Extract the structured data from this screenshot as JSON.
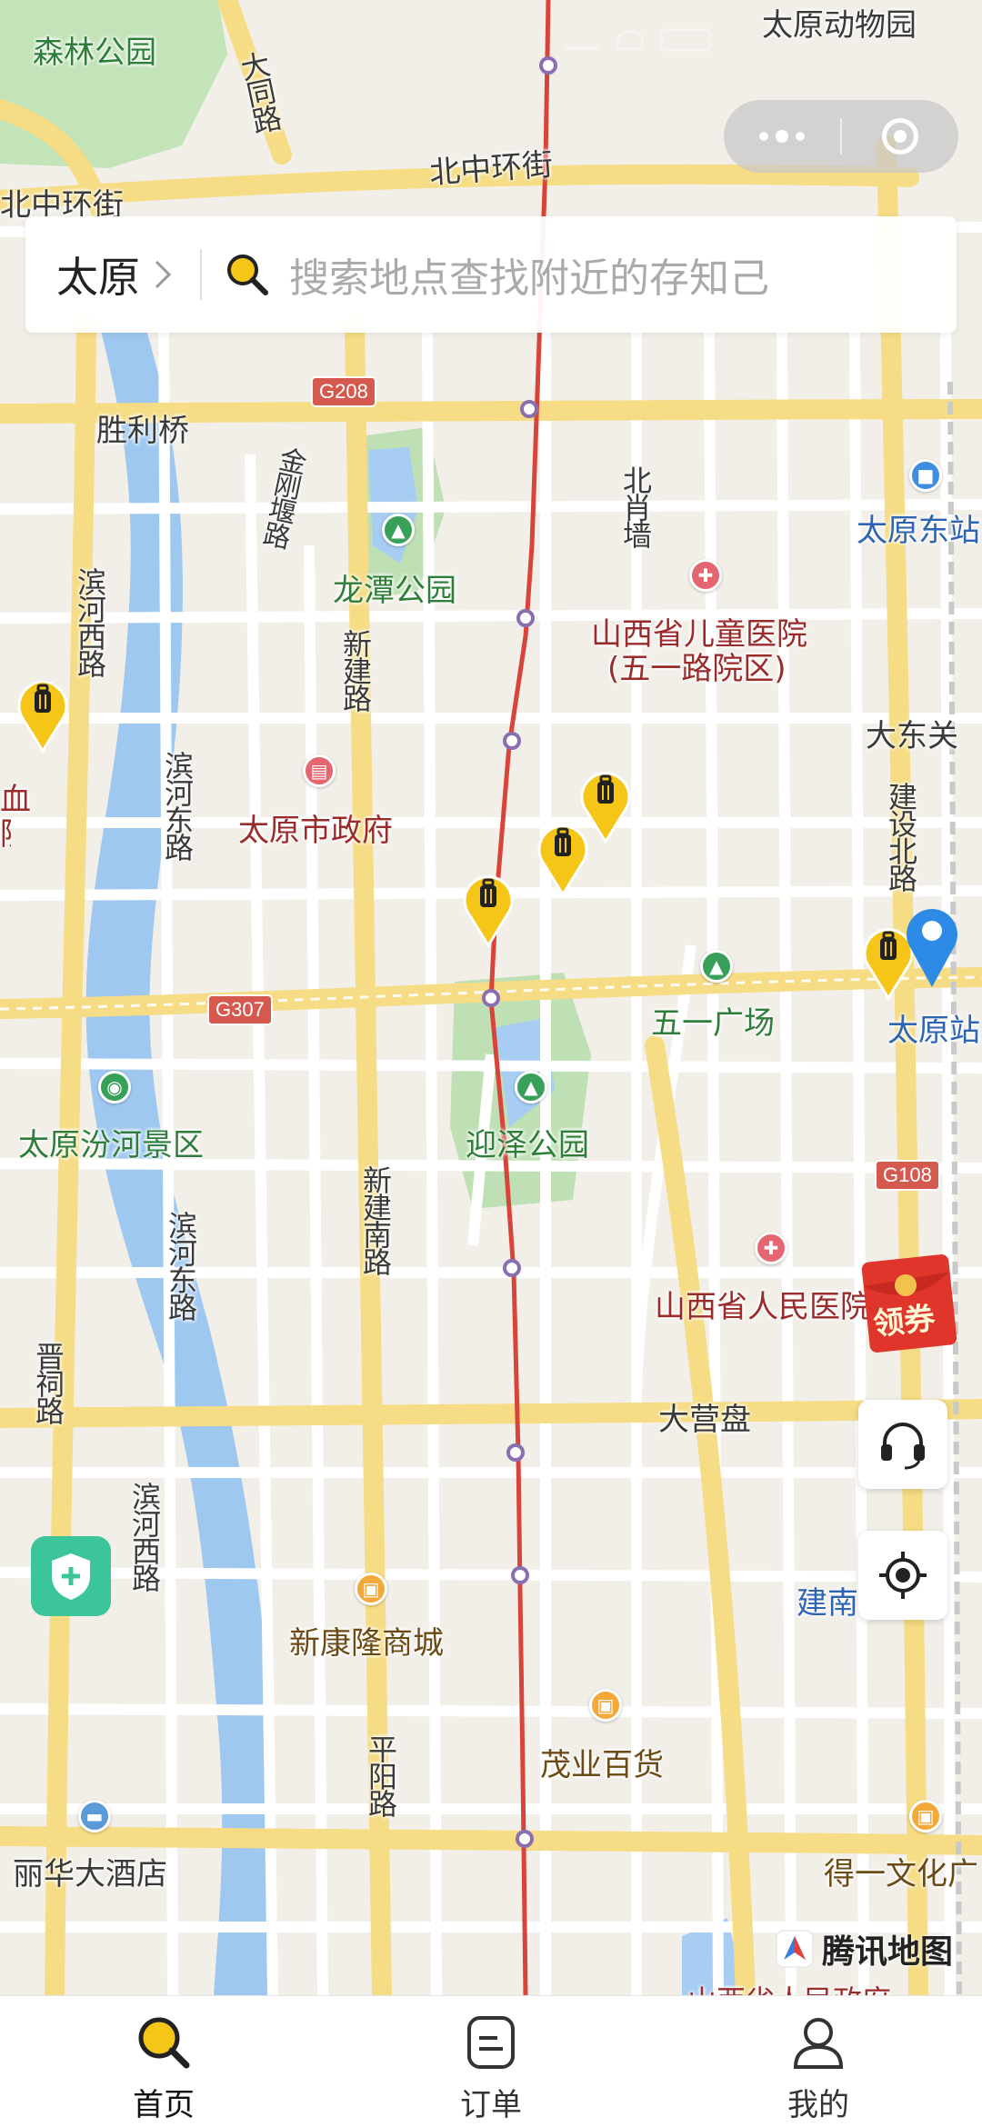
{
  "status_bar": {
    "time": "",
    "indicators": "signal wifi battery"
  },
  "header": {
    "city": "太原",
    "search_placeholder": "搜索地点查找附近的存知己"
  },
  "capsule": {
    "more_icon": "more-dots-icon",
    "close_icon": "close-circle-icon"
  },
  "map": {
    "labels": {
      "senlin_park": "森林公园",
      "zoo": "太原动物园",
      "datong_rd": "大同路",
      "north_ring_w": "北中环街",
      "north_ring_e": "北中环街",
      "shengli_bridge": "胜利桥",
      "jingangbao_rd": "金刚堰路",
      "longtan_park": "龙潭公园",
      "beixiaoqiang": "北肖墙",
      "east_station": "太原东站",
      "childrens_hospital": "山西省儿童医院",
      "childrens_hospital_sub": "(五一路院区)",
      "binhe_w": "滨河西路",
      "xinjian_rd": "新建路",
      "dadongguan": "大东关",
      "binhe_e": "滨河东路",
      "city_gov": "太原市政府",
      "jianshe_n": "建设北路",
      "xue": "血",
      "yuan": "院",
      "wuyi_square": "五一广场",
      "taiyuan_station": "太原站",
      "fenhe_scenic": "太原汾河景区",
      "yingze_park": "迎泽公园",
      "xinjian_s": "新建南路",
      "binhe_e2": "滨河东路",
      "people_hospital": "山西省人民医院",
      "jinci_rd": "晋祠路",
      "daying_pan": "大营盘",
      "binhe_w2": "滨河西路",
      "jiannan": "建南",
      "xinkanglong": "新康隆商城",
      "maoye": "茂业百货",
      "pingyang_rd": "平阳路",
      "lihua_hotel": "丽华大酒店",
      "deyi_culture": "得一文化广",
      "gov_bottom": "山西省人民政府"
    },
    "shields": {
      "g208": "G208",
      "g307": "G307",
      "g108": "G108"
    },
    "markers_count": 5,
    "provider": "腾讯地图"
  },
  "coupon": {
    "label": "领券"
  },
  "side_buttons": {
    "support": "headset-icon",
    "locate": "locate-icon"
  },
  "tabs": [
    {
      "label": "首页",
      "icon": "search-icon",
      "active": true
    },
    {
      "label": "订单",
      "icon": "order-icon",
      "active": false
    },
    {
      "label": "我的",
      "icon": "user-icon",
      "active": false
    }
  ],
  "colors": {
    "accent": "#f5c518",
    "route": "#d8443a",
    "river": "#9fc8f0",
    "park": "#b9deb0",
    "road": "#f6dc84"
  }
}
